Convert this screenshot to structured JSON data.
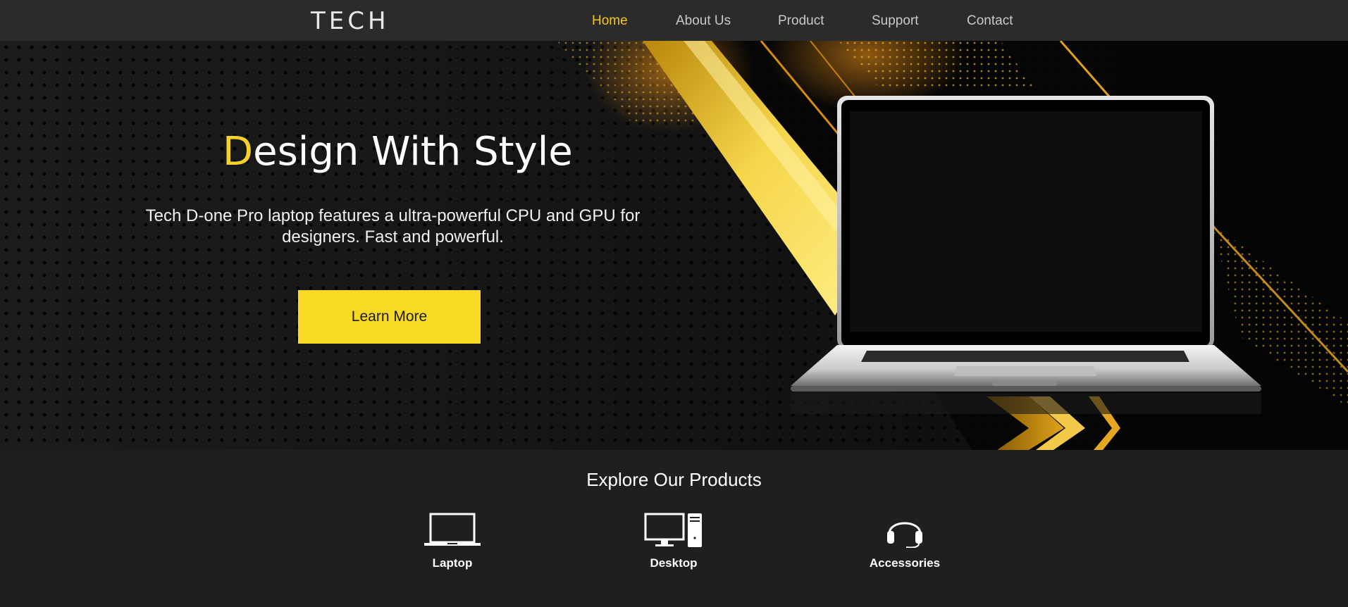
{
  "brand": {
    "logo": "TECH"
  },
  "nav": {
    "items": [
      {
        "label": "Home",
        "active": true
      },
      {
        "label": "About Us"
      },
      {
        "label": "Product"
      },
      {
        "label": "Support"
      },
      {
        "label": "Contact"
      }
    ]
  },
  "hero": {
    "title_first_letter": "D",
    "title_rest": "esign With Style",
    "description": "Tech D-one Pro laptop features a ultra-powerful CPU and GPU for designers. Fast and powerful.",
    "button_label": "Learn More"
  },
  "products": {
    "heading": "Explore Our Products",
    "items": [
      {
        "label": "Laptop",
        "icon": "laptop-icon"
      },
      {
        "label": "Desktop",
        "icon": "desktop-icon"
      },
      {
        "label": "Accessories",
        "icon": "headphones-icon"
      }
    ]
  },
  "colors": {
    "accent": "#f8d923",
    "nav_bg": "#2b2b2b",
    "page_bg": "#1f1f1f"
  }
}
